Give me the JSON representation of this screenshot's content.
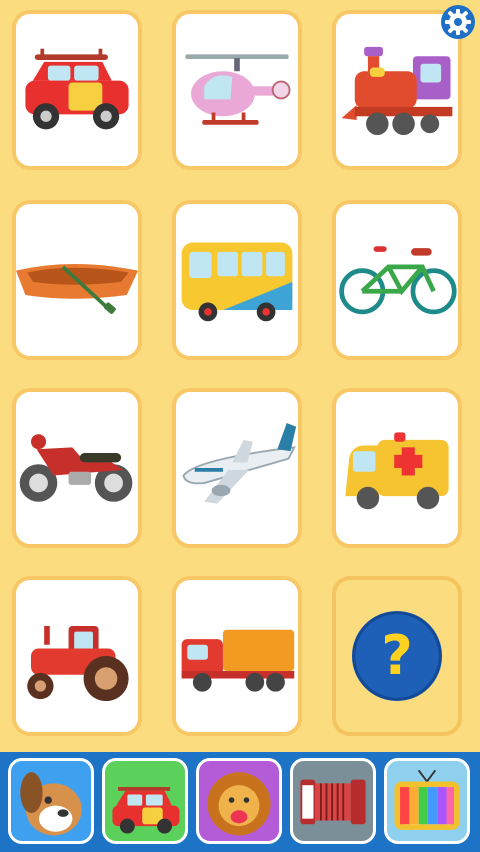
{
  "cards": [
    {
      "icon": "car-icon"
    },
    {
      "icon": "helicopter-icon"
    },
    {
      "icon": "train-icon"
    },
    {
      "icon": "boat-icon"
    },
    {
      "icon": "bus-icon"
    },
    {
      "icon": "bicycle-icon"
    },
    {
      "icon": "motorcycle-icon"
    },
    {
      "icon": "airplane-icon"
    },
    {
      "icon": "ambulance-icon"
    },
    {
      "icon": "tractor-icon"
    },
    {
      "icon": "truck-icon"
    },
    {
      "icon": "question-icon",
      "glyph": "?"
    }
  ],
  "settings": {
    "icon": "gear-icon"
  },
  "categories": [
    {
      "icon": "dog-icon",
      "color": "#3fa0f0"
    },
    {
      "icon": "car-icon",
      "color": "#5bd05a"
    },
    {
      "icon": "lion-icon",
      "color": "#b45bd8"
    },
    {
      "icon": "accordion-icon",
      "color": "#7b8f99"
    },
    {
      "icon": "tv-icon",
      "color": "#8fd0ef"
    }
  ]
}
